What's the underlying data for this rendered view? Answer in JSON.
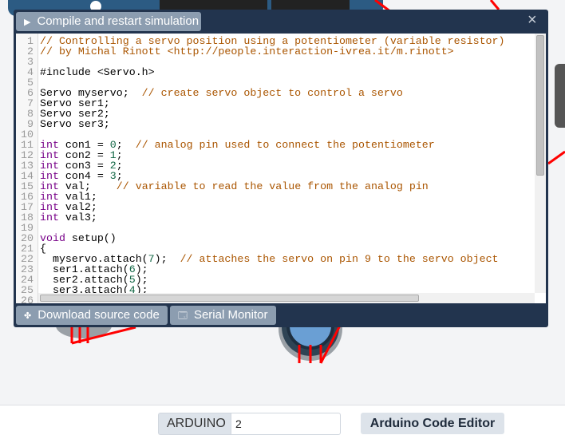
{
  "modal": {
    "compile_label": "Compile and restart simulation",
    "download_label": "Download source code",
    "serial_label": "Serial Monitor",
    "close_label": "×"
  },
  "code_lines": [
    [
      [
        "c",
        "// Controlling a servo position using a potentiometer (variable resistor)"
      ]
    ],
    [
      [
        "c",
        "// by Michal Rinott <http://people.interaction-ivrea.it/m.rinott>"
      ]
    ],
    [],
    [
      [
        "t",
        "#include <Servo.h>"
      ]
    ],
    [],
    [
      [
        "t",
        "Servo myservo;  "
      ],
      [
        "c",
        "// create servo object to control a servo"
      ]
    ],
    [
      [
        "t",
        "Servo ser1;"
      ]
    ],
    [
      [
        "t",
        "Servo ser2;"
      ]
    ],
    [
      [
        "t",
        "Servo ser3;"
      ]
    ],
    [],
    [
      [
        "k",
        "int"
      ],
      [
        "t",
        " con1 = "
      ],
      [
        "n",
        "0"
      ],
      [
        "t",
        ";  "
      ],
      [
        "c",
        "// analog pin used to connect the potentiometer"
      ]
    ],
    [
      [
        "k",
        "int"
      ],
      [
        "t",
        " con2 = "
      ],
      [
        "n",
        "1"
      ],
      [
        "t",
        ";"
      ]
    ],
    [
      [
        "k",
        "int"
      ],
      [
        "t",
        " con3 = "
      ],
      [
        "n",
        "2"
      ],
      [
        "t",
        ";"
      ]
    ],
    [
      [
        "k",
        "int"
      ],
      [
        "t",
        " con4 = "
      ],
      [
        "n",
        "3"
      ],
      [
        "t",
        ";"
      ]
    ],
    [
      [
        "k",
        "int"
      ],
      [
        "t",
        " val;    "
      ],
      [
        "c",
        "// variable to read the value from the analog pin"
      ]
    ],
    [
      [
        "k",
        "int"
      ],
      [
        "t",
        " val1;"
      ]
    ],
    [
      [
        "k",
        "int"
      ],
      [
        "t",
        " val2;"
      ]
    ],
    [
      [
        "k",
        "int"
      ],
      [
        "t",
        " val3;"
      ]
    ],
    [],
    [
      [
        "k",
        "void"
      ],
      [
        "t",
        " setup()"
      ]
    ],
    [
      [
        "t",
        "{"
      ]
    ],
    [
      [
        "t",
        "  myservo.attach("
      ],
      [
        "n",
        "7"
      ],
      [
        "t",
        ");  "
      ],
      [
        "c",
        "// attaches the servo on pin 9 to the servo object"
      ]
    ],
    [
      [
        "t",
        "  ser1.attach("
      ],
      [
        "n",
        "6"
      ],
      [
        "t",
        ");"
      ]
    ],
    [
      [
        "t",
        "  ser2.attach("
      ],
      [
        "n",
        "5"
      ],
      [
        "t",
        ");"
      ]
    ],
    [
      [
        "t",
        "  ser3.attach("
      ],
      [
        "n",
        "4"
      ],
      [
        "t",
        ");"
      ]
    ],
    []
  ],
  "footer": {
    "prefix_label": "ARDUINO",
    "arduino_number": "2",
    "editor_button_label": "Arduino Code Editor"
  }
}
